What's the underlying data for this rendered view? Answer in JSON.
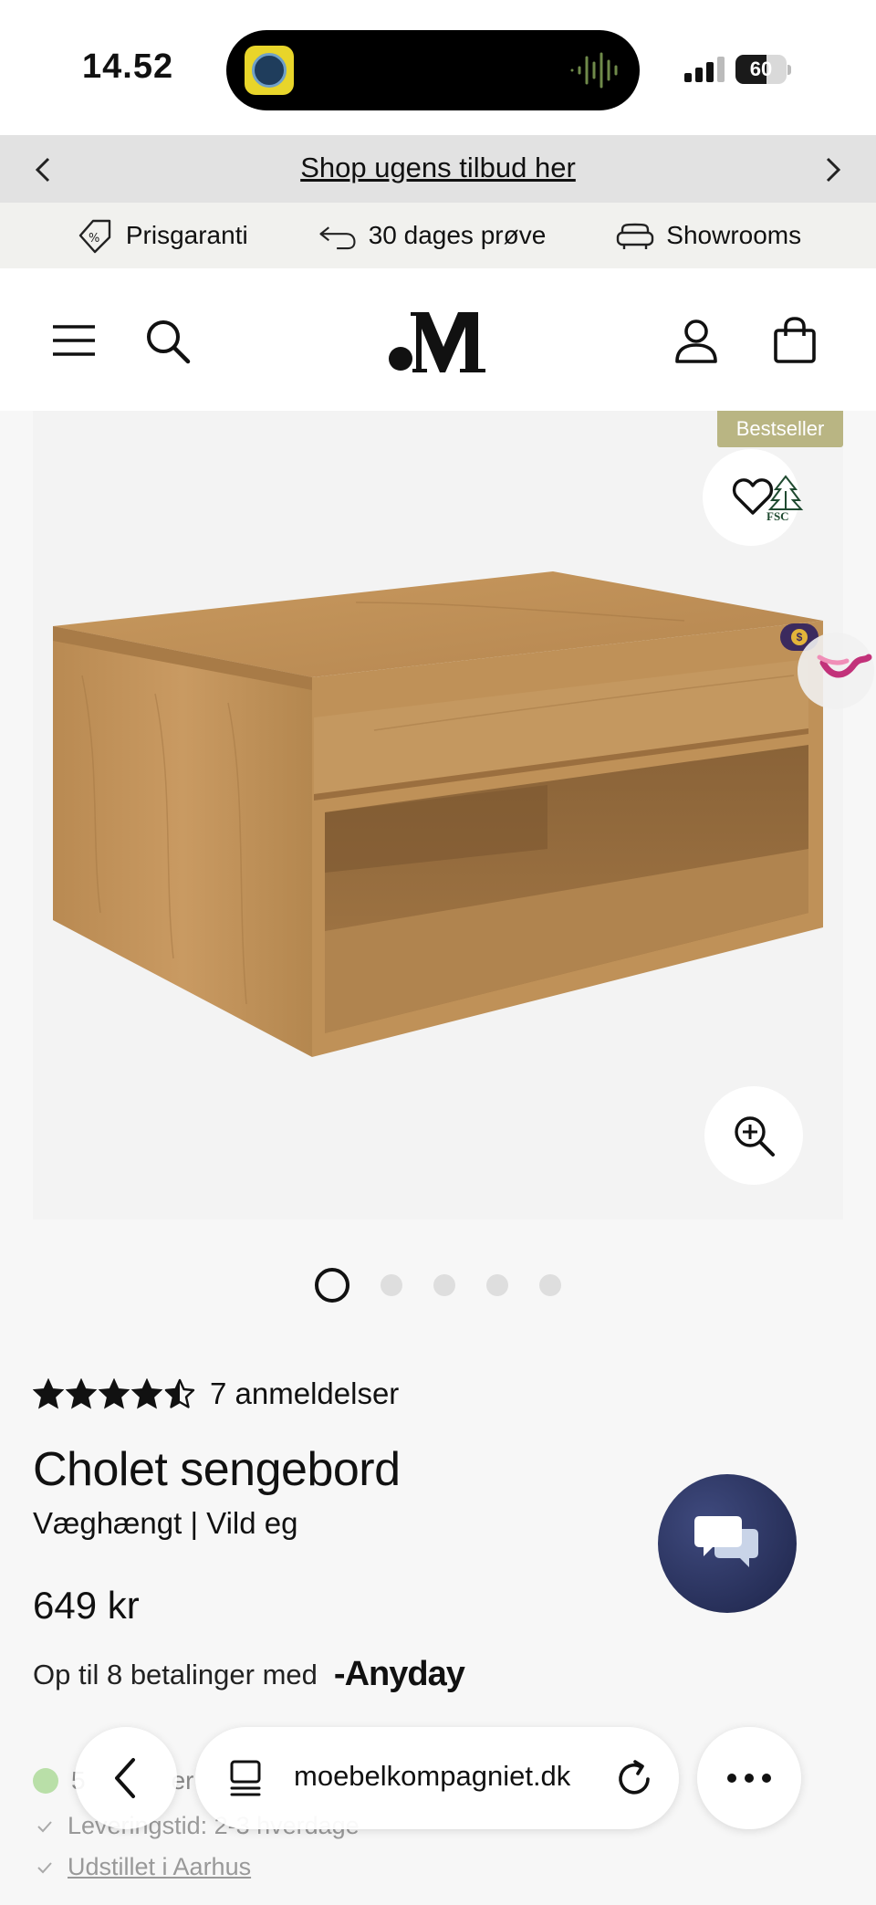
{
  "status_bar": {
    "time": "14.52",
    "battery": "60",
    "battery_level": 0.6
  },
  "promo_bar": {
    "link": "Shop ugens tilbud her",
    "prev_icon": "chevron-left-icon",
    "next_icon": "chevron-right-icon"
  },
  "usp_bar": {
    "items": [
      {
        "label": "Prisgaranti",
        "icon": "price-tag-icon"
      },
      {
        "label": "30 dages prøve",
        "icon": "return-arrow-icon"
      },
      {
        "label": "Showrooms",
        "icon": "sofa-icon"
      }
    ]
  },
  "header": {
    "menu_icon": "hamburger-menu-icon",
    "search_icon": "search-icon",
    "logo_icon": "moebelkompagniet-logo",
    "account_icon": "user-icon",
    "cart_icon": "shopping-bag-icon"
  },
  "gallery": {
    "badge": "Bestseller",
    "fsc_label": "FSC",
    "slide_count": 5,
    "active_slide": 1
  },
  "product": {
    "rating": 4.5,
    "reviews": "7 anmeldelser",
    "title": "Cholet sengebord",
    "variant": "Væghængt | Vild eg",
    "price": "649 kr",
    "payment_text": "Op til 8 betalinger med",
    "payment_brand": "Anyday",
    "stock_text_partial": "5",
    "stock_text_partial2": "er",
    "delivery": "Leveringstid: 2-3 hverdage",
    "showroom": "Udstillet i Aarhus"
  },
  "browser": {
    "url": "moebelkompagniet.dk",
    "back_icon": "chevron-left-icon",
    "tabs_icon": "tabs-icon",
    "reload_icon": "reload-icon",
    "more_icon": "more-icon"
  },
  "colors": {
    "badge": "#b9b583",
    "chat": "#2a3160",
    "stock_dot": "#b9dfa8",
    "promo_bg": "#e2e2e2",
    "usp_bg": "#f1f1ee"
  }
}
